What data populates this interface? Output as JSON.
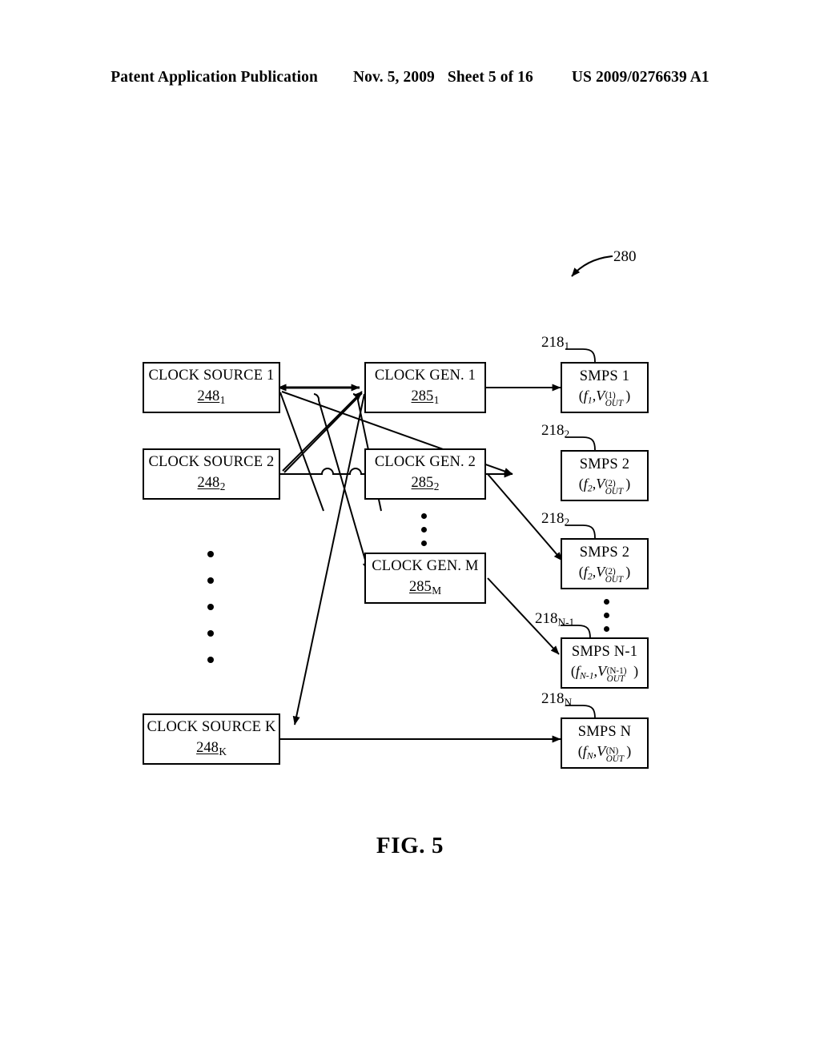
{
  "header": {
    "publication": "Patent Application Publication",
    "date": "Nov. 5, 2009",
    "sheet": "Sheet 5 of 16",
    "patent_number": "US 2009/0276639 A1"
  },
  "figure": {
    "caption": "FIG. 5",
    "system_ref": "280"
  },
  "clock_sources": [
    {
      "title": "CLOCK SOURCE 1",
      "ref_num": "248",
      "ref_sub": "1"
    },
    {
      "title": "CLOCK SOURCE 2",
      "ref_num": "248",
      "ref_sub": "2"
    },
    {
      "title": "CLOCK SOURCE K",
      "ref_num": "248",
      "ref_sub": "K"
    }
  ],
  "clock_gens": [
    {
      "title": "CLOCK GEN. 1",
      "ref_num": "285",
      "ref_sub": "1"
    },
    {
      "title": "CLOCK GEN. 2",
      "ref_num": "285",
      "ref_sub": "2"
    },
    {
      "title": "CLOCK GEN. M",
      "ref_num": "285",
      "ref_sub": "M"
    }
  ],
  "smps_units": [
    {
      "title": "SMPS 1",
      "callout_num": "218",
      "callout_sub": "1",
      "freq_sub": "1",
      "v_sup": "(1)",
      "v_sub": "OUT"
    },
    {
      "title": "SMPS 2",
      "callout_num": "218",
      "callout_sub": "2",
      "freq_sub": "2",
      "v_sup": "(2)",
      "v_sub": "OUT"
    },
    {
      "title": "SMPS 2",
      "callout_num": "218",
      "callout_sub": "2",
      "freq_sub": "2",
      "v_sup": "(2)",
      "v_sub": "OUT"
    },
    {
      "title": "SMPS N-1",
      "callout_num": "218",
      "callout_sub": "N-1",
      "freq_sub": "N-1",
      "v_sup": "(N-1)",
      "v_sub": "OUT"
    },
    {
      "title": "SMPS N",
      "callout_num": "218",
      "callout_sub": "N",
      "freq_sub": "N",
      "v_sup": "(N)",
      "v_sub": "OUT"
    }
  ],
  "ellipses": {
    "clock_source_column": 5,
    "clock_gen_column": 3,
    "smps_column": 3
  },
  "colors": {
    "ink": "#000000",
    "paper": "#ffffff"
  }
}
